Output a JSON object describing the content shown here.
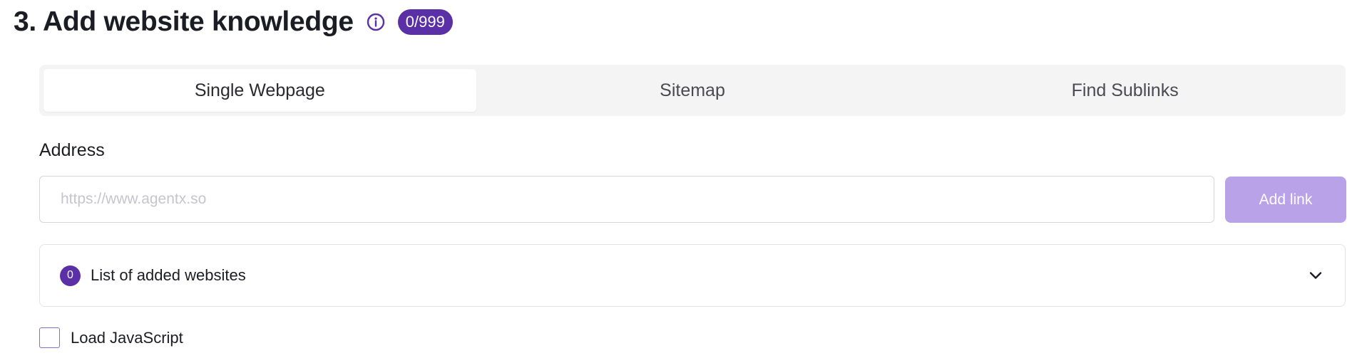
{
  "section": {
    "title": "3. Add website knowledge",
    "info_icon": "info-circle-icon",
    "count_badge": "0/999"
  },
  "tabs": [
    {
      "label": "Single Webpage",
      "active": true
    },
    {
      "label": "Sitemap",
      "active": false
    },
    {
      "label": "Find Sublinks",
      "active": false
    }
  ],
  "address": {
    "label": "Address",
    "value": "",
    "placeholder": "https://www.agentx.so",
    "button_label": "Add link"
  },
  "websites": {
    "count": "0",
    "label": "List of added websites",
    "chevron_icon": "chevron-down-icon"
  },
  "load_javascript": {
    "label": "Load JavaScript",
    "checked": false
  },
  "colors": {
    "accent": "#5b2fa6",
    "button_disabled": "#b9a2e8",
    "tab_bar_bg": "#f4f4f4"
  }
}
